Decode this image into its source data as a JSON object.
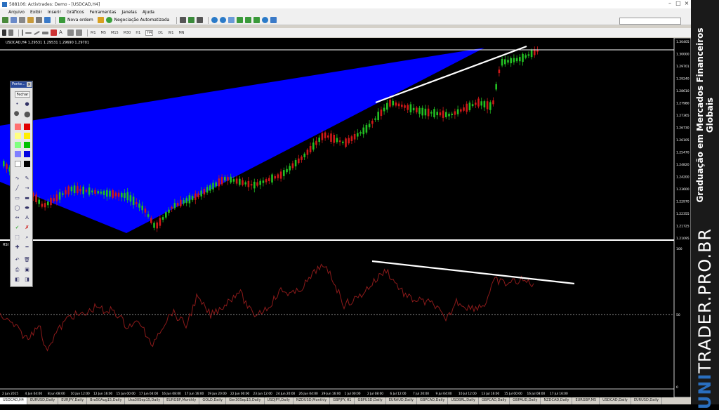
{
  "window": {
    "title": "588106: Activtrades: Demo - [USDCAD,H4]"
  },
  "menu": [
    "Arquivo",
    "Exibir",
    "Inserir",
    "Gráficos",
    "Ferramentas",
    "Janelas",
    "Ajuda"
  ],
  "toolbar": {
    "new_order": "Nova ordem",
    "auto_trading": "Negociação Automatizada"
  },
  "timeframes": [
    "M1",
    "M5",
    "M15",
    "M30",
    "H1",
    "H4",
    "D1",
    "W1",
    "MN"
  ],
  "chart": {
    "header": "USDCAD,H4  1.29531 1.29531 1.29690 1.29701",
    "price_ticks": [
      "1.30405",
      "1.30000",
      "1.29701",
      "1.29240",
      "1.28610",
      "1.27980",
      "1.27365",
      "1.26730",
      "1.26105",
      "1.25470",
      "1.24820",
      "1.24200",
      "1.23600",
      "1.22970",
      "1.22355",
      "1.21725",
      "1.21095"
    ],
    "rsi_label": "RSI",
    "rsi_ticks": [
      "100",
      "50",
      "0"
    ],
    "time_ticks": [
      "2 Jun 2015",
      "4 Jun 04:00",
      "8 Jun 08:00",
      "10 Jun 12:00",
      "12 Jun 16:00",
      "15 Jun 00:00",
      "17 Jun 04:00",
      "16 Jun 08:00",
      "17 Jun 16:00",
      "19 Jun 20:00",
      "22 Jun 00:00",
      "23 Jun 12:00",
      "24 Jun 20:00",
      "26 Jun 04:00",
      "29 Jun 16:00",
      "1 Jul 00:00",
      "2 Jul 08:00",
      "6 Jul 12:00",
      "7 Jul 20:00",
      "9 Jul 04:00",
      "10 Jul 12:00",
      "13 Jul 16:00",
      "15 Jul 00:00",
      "16 Jul 08:00",
      "17 Jul 16:00"
    ]
  },
  "palette": {
    "title": "Ponte...",
    "close_button": "Fechar"
  },
  "tabs": [
    "USDCAD,H4",
    "EURUSD,Daily",
    "EURJPY,Daily",
    "Bra50Aug15,Daily",
    "Usa30Sep15,Daily",
    "EURGBP,Monthly",
    "GOLD,Daily",
    "Ger30Sep15,Daily",
    "USDJPY,Daily",
    "NZDUSD,Monthly",
    "GBPJPY,H1",
    "GBPUSD,Daily",
    "EURAUD,Daily",
    "GBPCAD,Daily",
    "USDBRL,Daily",
    "GBPCAD,Daily",
    "GBPAUD,Daily",
    "NZDCAD,Daily",
    "EURGBP,M5",
    "USDCAD,Daily",
    "EURUSD,Daily"
  ],
  "sidebar": {
    "caption": "Graduação em Mercados Financeiros Globais",
    "brand_a": "UNI",
    "brand_b": "TRADER.PRO.BR"
  },
  "colors": {
    "bull": "#22c022",
    "bear": "#d01818",
    "wedge": "#0000ff",
    "rsi": "#8b1a1a"
  }
}
